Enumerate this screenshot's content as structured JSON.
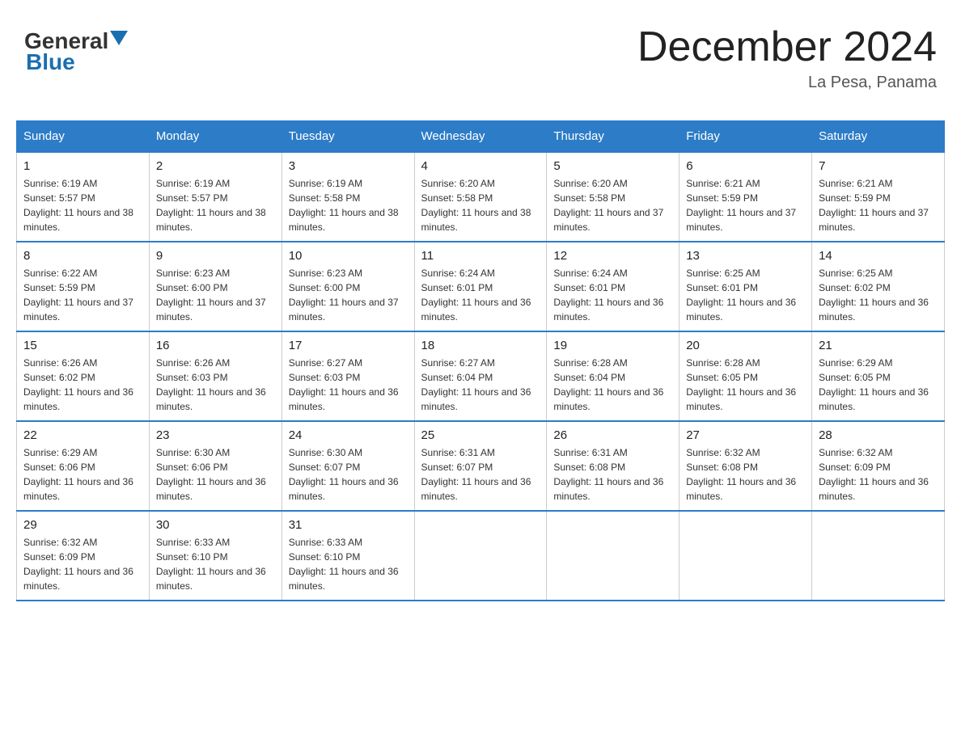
{
  "header": {
    "logo_general": "General",
    "logo_blue": "Blue",
    "month_title": "December 2024",
    "location": "La Pesa, Panama"
  },
  "days_of_week": [
    "Sunday",
    "Monday",
    "Tuesday",
    "Wednesday",
    "Thursday",
    "Friday",
    "Saturday"
  ],
  "weeks": [
    [
      {
        "day": "1",
        "sunrise": "6:19 AM",
        "sunset": "5:57 PM",
        "daylight": "11 hours and 38 minutes."
      },
      {
        "day": "2",
        "sunrise": "6:19 AM",
        "sunset": "5:57 PM",
        "daylight": "11 hours and 38 minutes."
      },
      {
        "day": "3",
        "sunrise": "6:19 AM",
        "sunset": "5:58 PM",
        "daylight": "11 hours and 38 minutes."
      },
      {
        "day": "4",
        "sunrise": "6:20 AM",
        "sunset": "5:58 PM",
        "daylight": "11 hours and 38 minutes."
      },
      {
        "day": "5",
        "sunrise": "6:20 AM",
        "sunset": "5:58 PM",
        "daylight": "11 hours and 37 minutes."
      },
      {
        "day": "6",
        "sunrise": "6:21 AM",
        "sunset": "5:59 PM",
        "daylight": "11 hours and 37 minutes."
      },
      {
        "day": "7",
        "sunrise": "6:21 AM",
        "sunset": "5:59 PM",
        "daylight": "11 hours and 37 minutes."
      }
    ],
    [
      {
        "day": "8",
        "sunrise": "6:22 AM",
        "sunset": "5:59 PM",
        "daylight": "11 hours and 37 minutes."
      },
      {
        "day": "9",
        "sunrise": "6:23 AM",
        "sunset": "6:00 PM",
        "daylight": "11 hours and 37 minutes."
      },
      {
        "day": "10",
        "sunrise": "6:23 AM",
        "sunset": "6:00 PM",
        "daylight": "11 hours and 37 minutes."
      },
      {
        "day": "11",
        "sunrise": "6:24 AM",
        "sunset": "6:01 PM",
        "daylight": "11 hours and 36 minutes."
      },
      {
        "day": "12",
        "sunrise": "6:24 AM",
        "sunset": "6:01 PM",
        "daylight": "11 hours and 36 minutes."
      },
      {
        "day": "13",
        "sunrise": "6:25 AM",
        "sunset": "6:01 PM",
        "daylight": "11 hours and 36 minutes."
      },
      {
        "day": "14",
        "sunrise": "6:25 AM",
        "sunset": "6:02 PM",
        "daylight": "11 hours and 36 minutes."
      }
    ],
    [
      {
        "day": "15",
        "sunrise": "6:26 AM",
        "sunset": "6:02 PM",
        "daylight": "11 hours and 36 minutes."
      },
      {
        "day": "16",
        "sunrise": "6:26 AM",
        "sunset": "6:03 PM",
        "daylight": "11 hours and 36 minutes."
      },
      {
        "day": "17",
        "sunrise": "6:27 AM",
        "sunset": "6:03 PM",
        "daylight": "11 hours and 36 minutes."
      },
      {
        "day": "18",
        "sunrise": "6:27 AM",
        "sunset": "6:04 PM",
        "daylight": "11 hours and 36 minutes."
      },
      {
        "day": "19",
        "sunrise": "6:28 AM",
        "sunset": "6:04 PM",
        "daylight": "11 hours and 36 minutes."
      },
      {
        "day": "20",
        "sunrise": "6:28 AM",
        "sunset": "6:05 PM",
        "daylight": "11 hours and 36 minutes."
      },
      {
        "day": "21",
        "sunrise": "6:29 AM",
        "sunset": "6:05 PM",
        "daylight": "11 hours and 36 minutes."
      }
    ],
    [
      {
        "day": "22",
        "sunrise": "6:29 AM",
        "sunset": "6:06 PM",
        "daylight": "11 hours and 36 minutes."
      },
      {
        "day": "23",
        "sunrise": "6:30 AM",
        "sunset": "6:06 PM",
        "daylight": "11 hours and 36 minutes."
      },
      {
        "day": "24",
        "sunrise": "6:30 AM",
        "sunset": "6:07 PM",
        "daylight": "11 hours and 36 minutes."
      },
      {
        "day": "25",
        "sunrise": "6:31 AM",
        "sunset": "6:07 PM",
        "daylight": "11 hours and 36 minutes."
      },
      {
        "day": "26",
        "sunrise": "6:31 AM",
        "sunset": "6:08 PM",
        "daylight": "11 hours and 36 minutes."
      },
      {
        "day": "27",
        "sunrise": "6:32 AM",
        "sunset": "6:08 PM",
        "daylight": "11 hours and 36 minutes."
      },
      {
        "day": "28",
        "sunrise": "6:32 AM",
        "sunset": "6:09 PM",
        "daylight": "11 hours and 36 minutes."
      }
    ],
    [
      {
        "day": "29",
        "sunrise": "6:32 AM",
        "sunset": "6:09 PM",
        "daylight": "11 hours and 36 minutes."
      },
      {
        "day": "30",
        "sunrise": "6:33 AM",
        "sunset": "6:10 PM",
        "daylight": "11 hours and 36 minutes."
      },
      {
        "day": "31",
        "sunrise": "6:33 AM",
        "sunset": "6:10 PM",
        "daylight": "11 hours and 36 minutes."
      },
      null,
      null,
      null,
      null
    ]
  ],
  "labels": {
    "sunrise_prefix": "Sunrise: ",
    "sunset_prefix": "Sunset: ",
    "daylight_prefix": "Daylight: "
  }
}
